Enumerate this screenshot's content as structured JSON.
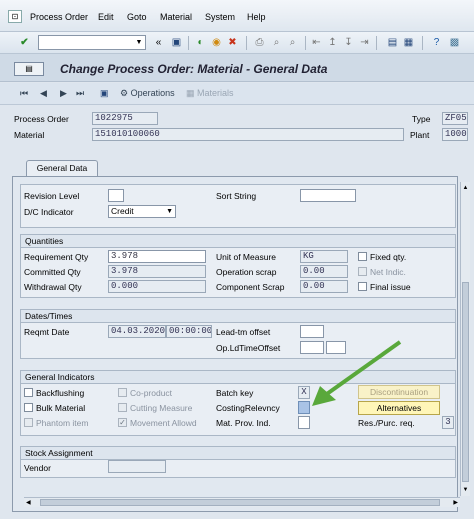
{
  "menu": {
    "items": [
      "Process Order",
      "Edit",
      "Goto",
      "Material",
      "System",
      "Help"
    ]
  },
  "toolbar": {
    "command_value": "",
    "icons": [
      "enter-icon",
      "save-icon",
      "back-icon",
      "exit-icon",
      "cancel-icon",
      "print-icon",
      "find-icon",
      "find-next-icon",
      "first-page-icon",
      "prev-page-icon",
      "next-page-icon",
      "last-page-icon",
      "new-session-icon",
      "shortcut-icon",
      "help-icon",
      "layout-icon"
    ]
  },
  "title": {
    "text": "Change Process Order: Material - General Data"
  },
  "app_toolbar": {
    "operations_label": "Operations",
    "materials_label": "Materials"
  },
  "header": {
    "process_order_label": "Process Order",
    "process_order_value": "1022975",
    "material_label": "Material",
    "material_value": "151010100060",
    "type_label": "Type",
    "type_value": "ZF05",
    "plant_label": "Plant",
    "plant_value": "1000"
  },
  "tabs": [
    "General Data"
  ],
  "general": {
    "revision_level_label": "Revision Level",
    "sort_string_label": "Sort String",
    "dc_indicator_label": "D/C Indicator",
    "dc_indicator_value": "Credit"
  },
  "quantities": {
    "title": "Quantities",
    "requirement_qty_label": "Requirement Qty",
    "requirement_qty_value": "3.978",
    "committed_qty_label": "Committed Qty",
    "committed_qty_value": "3.978",
    "withdrawal_qty_label": "Withdrawal Qty",
    "withdrawal_qty_value": "0.000",
    "uom_label": "Unit of Measure",
    "uom_value": "KG",
    "op_scrap_label": "Operation scrap",
    "op_scrap_value": "0.00",
    "comp_scrap_label": "Component Scrap",
    "comp_scrap_value": "0.00",
    "fixed_qty_label": "Fixed qty.",
    "net_indic_label": "Net Indic.",
    "final_issue_label": "Final issue"
  },
  "dates": {
    "title": "Dates/Times",
    "reqmt_date_label": "Reqmt Date",
    "reqmt_date_value": "04.03.2020",
    "reqmt_time_value": "00:00:00",
    "lead_tm_label": "Lead-tm offset",
    "op_ld_label": "Op.LdTimeOffset"
  },
  "indicators": {
    "title": "General Indicators",
    "backflushing_label": "Backflushing",
    "bulk_material_label": "Bulk Material",
    "phantom_item_label": "Phantom item",
    "co_product_label": "Co-product",
    "cutting_measure_label": "Cutting Measure",
    "movement_allowed_label": "Movement Allowd",
    "batch_key_label": "Batch key",
    "batch_key_value": "X",
    "costing_relevancy_label": "CostingRelevncy",
    "mat_prov_label": "Mat. Prov. Ind.",
    "discontinuation_label": "Discontinuation",
    "alternatives_label": "Alternatives",
    "res_purc_label": "Res./Purc. req.",
    "res_purc_value": "3"
  },
  "stock": {
    "title": "Stock Assignment",
    "vendor_label": "Vendor"
  },
  "colors": {
    "accent_arrow": "#59a83b",
    "button_yellow": "#fff6b8"
  }
}
